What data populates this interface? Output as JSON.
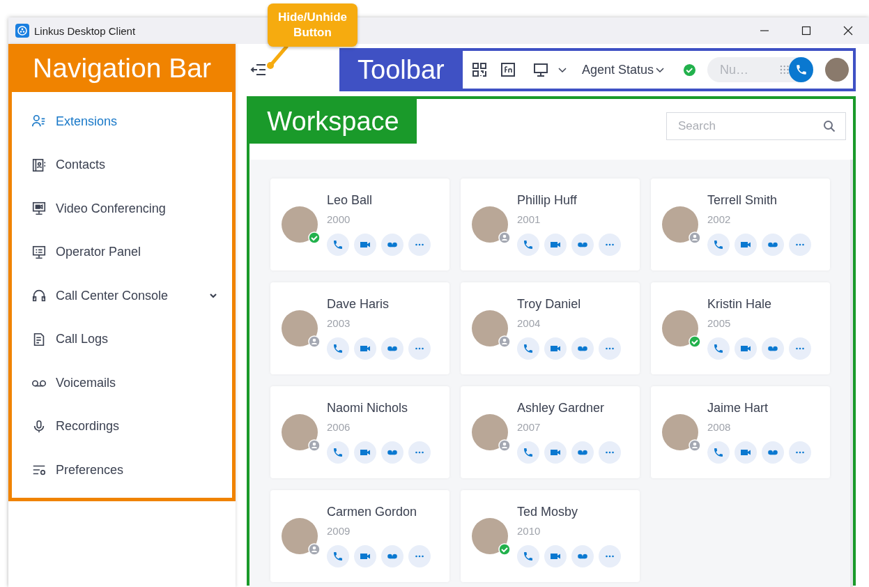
{
  "window": {
    "title": "Linkus Desktop Client"
  },
  "callout": {
    "text": "Hide/Unhide Button"
  },
  "sidebar": {
    "annotation": "Navigation Bar",
    "items": [
      {
        "label": "Extensions",
        "kind": "link",
        "selected": true
      },
      {
        "label": "Contacts",
        "kind": "link",
        "selected": false
      },
      {
        "label": "Video Conferencing",
        "kind": "link",
        "selected": false
      },
      {
        "label": "Operator Panel",
        "kind": "link",
        "selected": false
      },
      {
        "label": "Call Center Console",
        "kind": "group",
        "selected": false
      },
      {
        "label": "Call Logs",
        "kind": "link",
        "selected": false
      },
      {
        "label": "Voicemails",
        "kind": "link",
        "selected": false
      },
      {
        "label": "Recordings",
        "kind": "link",
        "selected": false
      },
      {
        "label": "Preferences",
        "kind": "link",
        "selected": false
      }
    ]
  },
  "toolbar": {
    "annotation": "Toolbar",
    "agent_status": {
      "label": "Agent Status",
      "available": true
    },
    "dial": {
      "placeholder": "Nu…"
    }
  },
  "workspace": {
    "annotation": "Workspace",
    "search": {
      "placeholder": "Search"
    },
    "contacts": [
      {
        "name": "Leo Ball",
        "ext": "2000",
        "online": true
      },
      {
        "name": "Phillip Huff",
        "ext": "2001",
        "online": false
      },
      {
        "name": "Terrell Smith",
        "ext": "2002",
        "online": false
      },
      {
        "name": "Dave Haris",
        "ext": "2003",
        "online": false
      },
      {
        "name": "Troy Daniel",
        "ext": "2004",
        "online": false
      },
      {
        "name": "Kristin Hale",
        "ext": "2005",
        "online": true
      },
      {
        "name": "Naomi Nichols",
        "ext": "2006",
        "online": false
      },
      {
        "name": "Ashley Gardner",
        "ext": "2007",
        "online": false
      },
      {
        "name": "Jaime Hart",
        "ext": "2008",
        "online": false
      },
      {
        "name": "Carmen Gordon",
        "ext": "2009",
        "online": false
      },
      {
        "name": "Ted Mosby",
        "ext": "2010",
        "online": true
      }
    ]
  }
}
